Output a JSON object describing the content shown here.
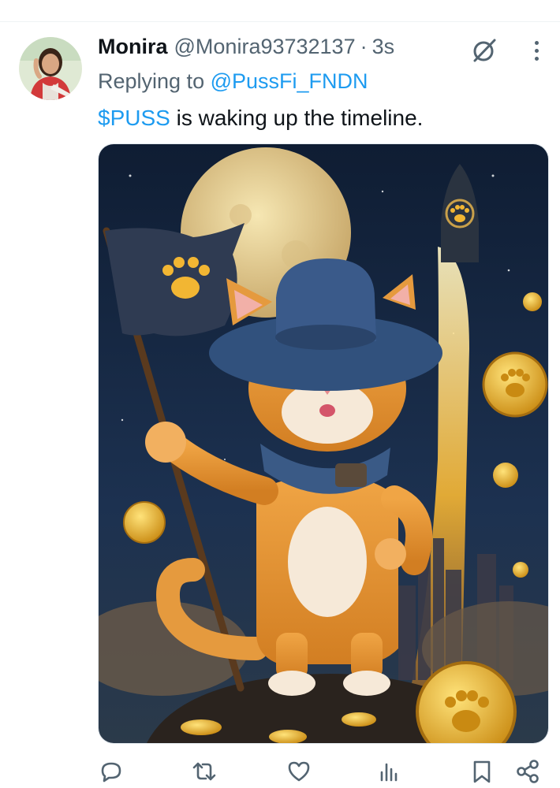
{
  "tweet": {
    "display_name": "Monira",
    "handle": "@Monira93732137",
    "separator": "·",
    "time": "3s",
    "replying_prefix": "Replying to",
    "replying_to": "@PussFi_FNDN",
    "cashtag": "$PUSS",
    "text_rest": " is waking up the timeline."
  },
  "icons": {
    "grok": "grok-icon",
    "more": "more-dots-icon",
    "reply": "reply-icon",
    "retweet": "retweet-icon",
    "like": "heart-icon",
    "views": "views-icon",
    "bookmark": "bookmark-icon",
    "share": "share-icon"
  },
  "colors": {
    "link": "#1d9bf0",
    "secondary_text": "#536471",
    "primary_text": "#0f1419"
  }
}
